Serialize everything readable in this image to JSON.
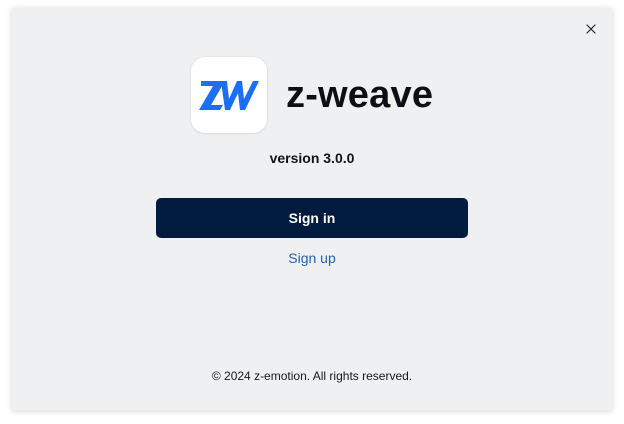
{
  "app": {
    "name": "z-weave",
    "version": "version 3.0.0",
    "logo_icon": "zw-logo-icon"
  },
  "actions": {
    "sign_in_label": "Sign in",
    "sign_up_label": "Sign up"
  },
  "footer": {
    "copyright": "© 2024 z-emotion. All rights reserved."
  },
  "colors": {
    "background": "#eff0f2",
    "primary_button": "#011b3f",
    "link": "#1d64b4",
    "logo_blue": "#1b6ff5"
  }
}
